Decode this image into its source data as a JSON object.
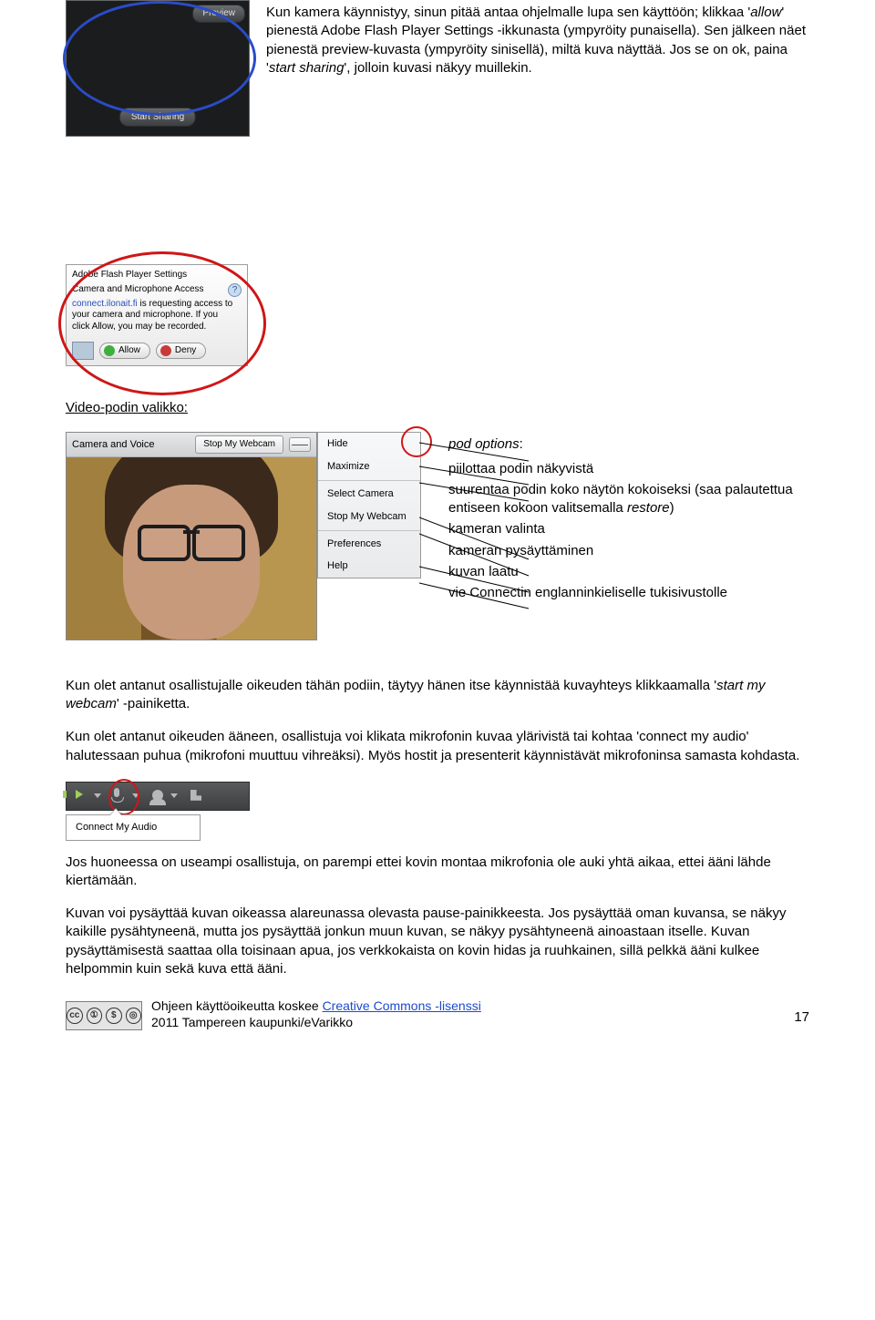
{
  "top_text": {
    "p1a": "Kun kamera käynnistyy, sinun pitää antaa ohjelmalle lupa sen käyttöön; klikkaa '",
    "p1_allow": "allow",
    "p1b": "' pienestä Adobe Flash Player Settings -ikkunasta (ympyröity punaisella). Sen jälkeen näet pienestä preview-kuvasta (ympyröity sinisellä), miltä kuva näyttää. Jos se on ok, paina '",
    "p1_start": "start sharing",
    "p1c": "', jolloin kuvasi näkyy muillekin."
  },
  "cam_preview": {
    "preview_btn": "Preview",
    "start_btn": "Start Sharing"
  },
  "flash": {
    "title": "Adobe Flash Player Settings",
    "subtitle": "Camera and Microphone Access",
    "line1a": "connect.ilonait.fi",
    "line1b": " is requesting access to",
    "line2": "your camera and microphone. If you",
    "line3": "click Allow, you may be recorded.",
    "allow": "Allow",
    "deny": "Deny"
  },
  "section_title": "Video-podin valikko:",
  "pod_head": {
    "title": "Camera and Voice",
    "stop": "Stop My Webcam"
  },
  "menu": {
    "hide": "Hide",
    "max": "Maximize",
    "selcam": "Select Camera",
    "stopcam": "Stop My Webcam",
    "pref": "Preferences",
    "help": "Help"
  },
  "desc": {
    "lead": "pod options",
    "l1": "piilottaa podin näkyvistä",
    "l2": "suurentaa podin koko näytön kokoiseksi (saa palautettua entiseen kokoon valitsemalla ",
    "l2r": "restore",
    "l2b": ")",
    "l3": "kameran valinta",
    "l4": "kameran pysäyttäminen",
    "l5": "kuvan laatu",
    "l6": "vie Connectin englanninkieliselle tukisivustolle"
  },
  "body": {
    "p2a": "Kun olet antanut osallistujalle oikeuden tähän podiin, täytyy hänen itse käynnistää kuvayhteys klikkaamalla '",
    "p2i": "start my webcam",
    "p2b": "' -painiketta.",
    "p3": "Kun olet antanut oikeuden ääneen, osallistuja voi klikata mikrofonin kuvaa ylärivistä tai kohtaa 'connect my audio' halutessaan puhua (mikrofoni muuttuu vihreäksi). Myös hostit ja presenterit käynnistävät mikrofoninsa samasta kohdasta.",
    "p4": "Jos huoneessa on useampi osallistuja, on parempi ettei kovin montaa mikrofonia ole auki yhtä aikaa, ettei ääni lähde kiertämään.",
    "p5": "Kuvan voi pysäyttää kuvan oikeassa alareunassa olevasta pause-painikkeesta. Jos pysäyttää oman kuvansa, se näkyy kaikille pysähtyneenä, mutta jos pysäyttää jonkun muun kuvan, se näkyy pysähtyneenä ainoastaan itselle. Kuvan pysäyttämisestä saattaa olla toisinaan apua, jos verkkokaista on kovin hidas ja ruuhkainen, sillä pelkkä ääni kulkee helpommin kuin sekä kuva että ääni."
  },
  "audio_menu": "Connect My Audio",
  "footer": {
    "line1a": "Ohjeen käyttöoikeutta koskee ",
    "link": "Creative Commons -lisenssi",
    "line2": "2011 Tampereen kaupunki/eVarikko"
  },
  "page_number": "17"
}
